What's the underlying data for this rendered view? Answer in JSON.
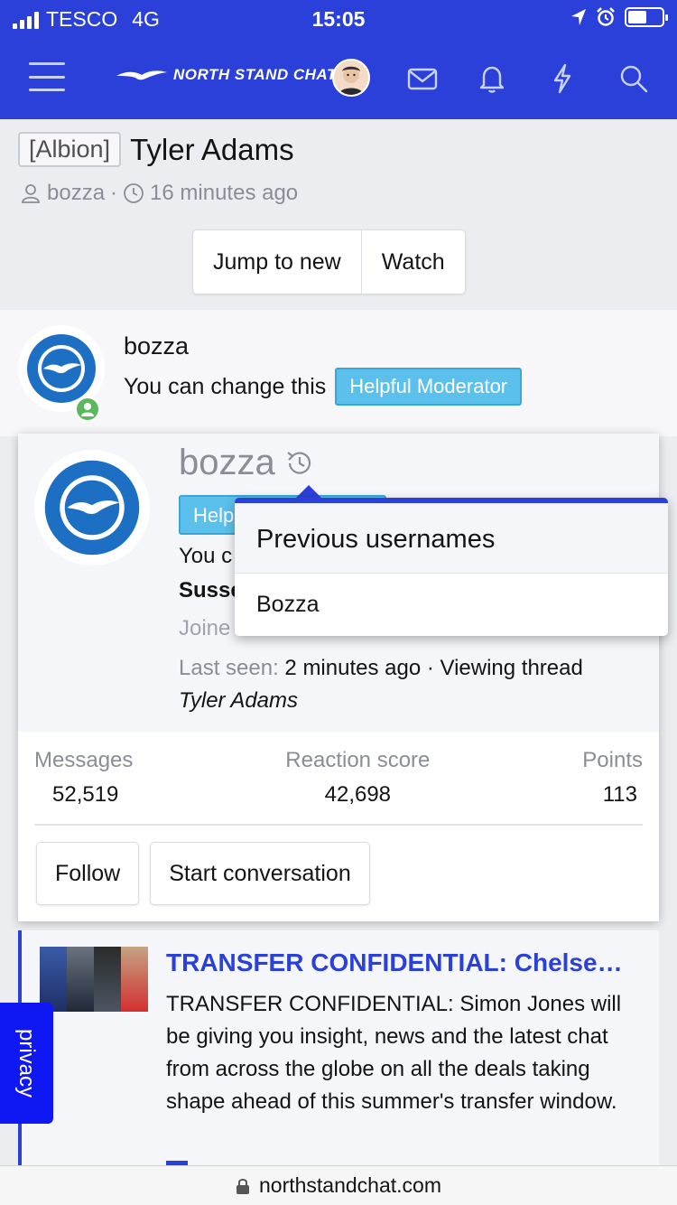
{
  "status_bar": {
    "carrier": "TESCO",
    "network": "4G",
    "time": "15:05"
  },
  "header": {
    "site_name": "NORTH STAND CHAT",
    "icons": [
      "menu-icon",
      "mail-icon",
      "bell-icon",
      "lightning-icon",
      "search-icon"
    ]
  },
  "thread": {
    "prefix": "[Albion]",
    "title": "Tyler Adams",
    "author": "bozza",
    "separator": "·",
    "time_ago": "16 minutes ago",
    "jump_label": "Jump to new",
    "watch_label": "Watch"
  },
  "post": {
    "username": "bozza",
    "user_title": "You can change this",
    "badge": "Helpful Moderator"
  },
  "member_card": {
    "username": "bozza",
    "badge_partial": "Help",
    "line1_partial": "You c",
    "line2_partial": "Susse",
    "joined_partial": "Joine",
    "last_seen_label": "Last seen:",
    "last_seen_value": "2 minutes ago · Viewing thread",
    "last_seen_thread": "Tyler Adams",
    "stats": [
      {
        "label": "Messages",
        "value": "52,519"
      },
      {
        "label": "Reaction score",
        "value": "42,698"
      },
      {
        "label": "Points",
        "value": "113"
      }
    ],
    "follow_label": "Follow",
    "conversation_label": "Start conversation"
  },
  "previous_usernames": {
    "title": "Previous usernames",
    "items": [
      "Bozza"
    ]
  },
  "feed_item": {
    "title": "TRANSFER CONFIDENTIAL: Chelse…",
    "text": "TRANSFER CONFIDENTIAL: Simon Jones will be giving you insight, news and the latest chat from across the globe on all the deals taking shape ahead of this summer's transfer window."
  },
  "privacy_tab": "privacy",
  "url_bar": {
    "url": "northstandchat.com"
  },
  "colors": {
    "brand_blue": "#2a40d9",
    "badge_blue": "#5bc0eb",
    "online_green": "#5cb85c",
    "privacy_blue": "#0f18f2"
  }
}
